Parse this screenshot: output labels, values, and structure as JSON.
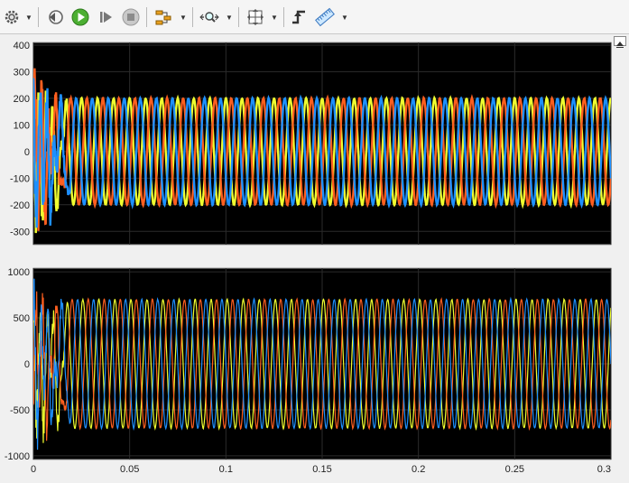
{
  "toolbar": {
    "buttons": [
      {
        "name": "settings-icon",
        "label": "Settings"
      },
      {
        "name": "step-back-icon",
        "label": "Step Back"
      },
      {
        "name": "run-icon",
        "label": "Run"
      },
      {
        "name": "step-forward-icon",
        "label": "Step Forward"
      },
      {
        "name": "stop-icon",
        "label": "Stop"
      },
      {
        "name": "signal-selector-icon",
        "label": "Signal Selector"
      },
      {
        "name": "zoom-icon",
        "label": "Zoom"
      },
      {
        "name": "fit-to-view-icon",
        "label": "Scale X and Y Axes Limits"
      },
      {
        "name": "triggers-icon",
        "label": "Triggers"
      },
      {
        "name": "measurement-icon",
        "label": "Measurements"
      }
    ]
  },
  "colors": {
    "background": "#000000",
    "grid": "#2b2b2b",
    "series": [
      "#f0ff30",
      "#ff5f1f",
      "#1e90ff"
    ]
  },
  "chart_data": [
    {
      "type": "line",
      "title": "",
      "xlabel": "",
      "ylabel": "",
      "xlim": [
        0,
        0.3
      ],
      "ylim": [
        -350,
        410
      ],
      "yticks": [
        -300,
        -200,
        -100,
        0,
        100,
        200,
        300,
        400
      ],
      "xticks": [],
      "grid": true,
      "frequency_hz": 120,
      "amplitude": 200,
      "settling_time": 0.02,
      "transient_peak": 330,
      "series": [
        {
          "phase_deg": 90,
          "color": "#f0ff30"
        },
        {
          "phase_deg": -30,
          "color": "#ff5f1f"
        },
        {
          "phase_deg": 210,
          "color": "#1e90ff"
        }
      ]
    },
    {
      "type": "line",
      "title": "",
      "xlabel": "",
      "ylabel": "",
      "xlim": [
        0,
        0.3
      ],
      "ylim": [
        -1040,
        1040
      ],
      "yticks": [
        -1000,
        -500,
        0,
        500,
        1000
      ],
      "xticks": [
        0,
        0.05,
        0.1,
        0.15,
        0.2,
        0.25,
        0.3
      ],
      "xtick_labels": [
        "0",
        "0.05",
        "0.1",
        "0.15",
        "0.2",
        "0.25",
        "0.3"
      ],
      "grid": true,
      "frequency_hz": 120,
      "amplitude": 700,
      "settling_time": 0.02,
      "transient_peak": 850,
      "series": [
        {
          "phase_deg": 60,
          "color": "#f0ff30"
        },
        {
          "phase_deg": -60,
          "color": "#ff5f1f"
        },
        {
          "phase_deg": 180,
          "color": "#1e90ff"
        }
      ]
    }
  ]
}
